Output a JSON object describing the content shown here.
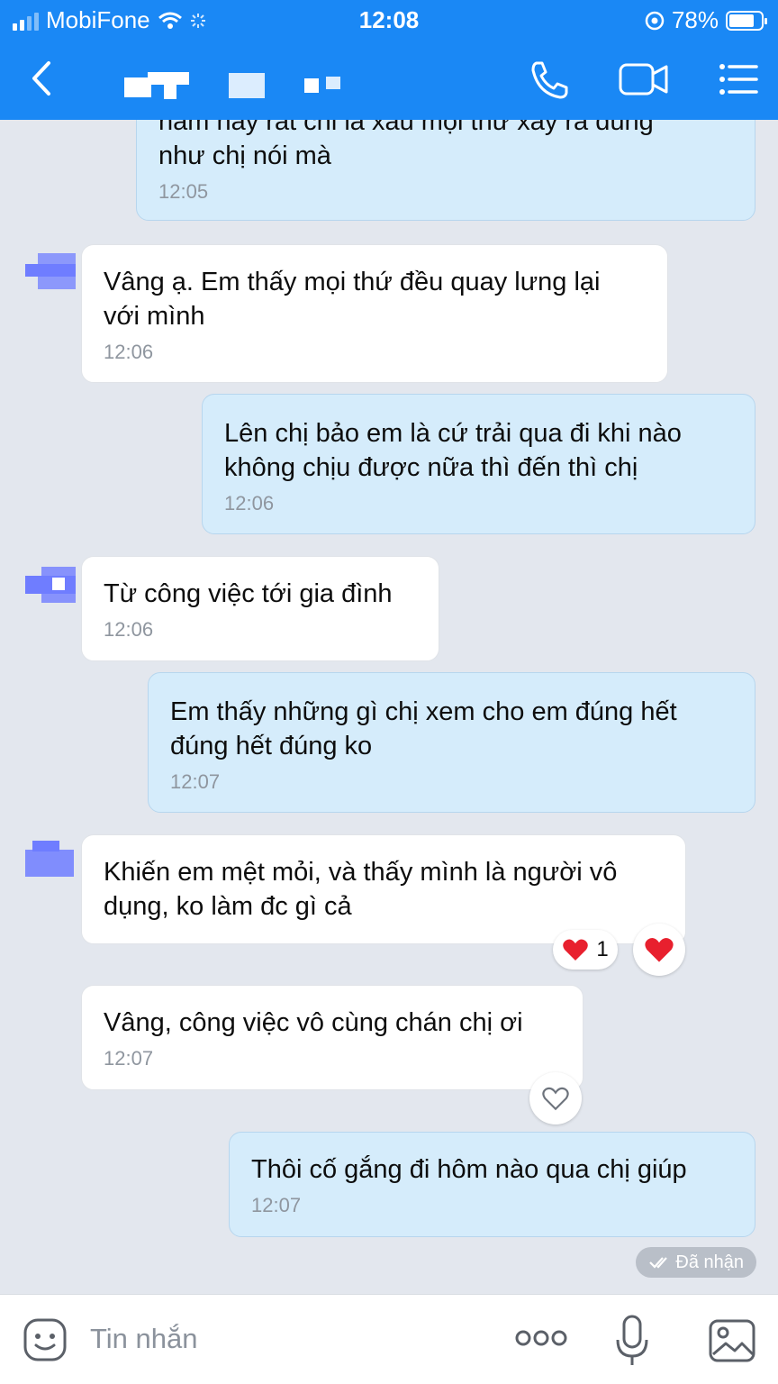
{
  "status_bar": {
    "carrier": "MobiFone",
    "time": "12:08",
    "battery": "78%"
  },
  "header": {
    "back_icon": "chevron-left-icon",
    "contact_name": "",
    "call_icon": "phone-icon",
    "video_icon": "video-camera-icon",
    "menu_icon": "list-menu-icon"
  },
  "messages": [
    {
      "dir": "out",
      "text": "năm nay rất chi là xấu mọi thứ xảy ra đúng\nnhư chị nói mà",
      "time": "12:05"
    },
    {
      "dir": "in",
      "text": "Vâng ạ. Em thấy mọi thứ đều quay lưng lại\nvới mình",
      "time": "12:06"
    },
    {
      "dir": "out",
      "text": "Lên chị bảo em là cứ trải qua đi khi nào\nkhông chịu được nữa thì đến thì chị",
      "time": "12:06"
    },
    {
      "dir": "in",
      "text": "Từ công việc tới gia đình",
      "time": "12:06"
    },
    {
      "dir": "out",
      "text": "Em thấy những gì chị xem cho em đúng hết\nđúng hết đúng ko",
      "time": "12:07"
    },
    {
      "dir": "in",
      "text": "Khiến em mệt mỏi, và thấy mình là người vô\ndụng, ko làm đc gì cả",
      "time": ""
    },
    {
      "dir": "in",
      "text": "Vâng, công việc vô cùng chán chị ơi",
      "time": "12:07"
    },
    {
      "dir": "out",
      "text": "Thôi cố gắng đi hôm nào qua chị giúp",
      "time": "12:07"
    }
  ],
  "reactions": {
    "msg6_count": "1",
    "msg6_icon": "heart-icon",
    "msg7_icon": "heart-outline-icon"
  },
  "received_label": "Đã nhận",
  "composer": {
    "placeholder": "Tin nhắn",
    "sticker_icon": "emoji-icon",
    "more_icon": "more-dots-icon",
    "mic_icon": "microphone-icon",
    "image_icon": "image-icon"
  },
  "colors": {
    "header_blue": "#1a88f5",
    "outgoing_bubble": "#d5ecfb",
    "incoming_bubble": "#ffffff",
    "chat_bg": "#e3e7ee",
    "heart": "#e8202e"
  }
}
